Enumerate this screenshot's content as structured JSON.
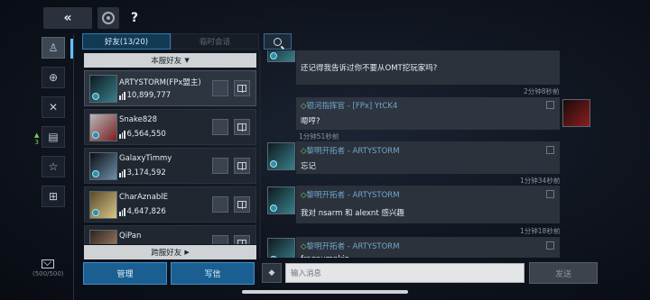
{
  "toolbar": {
    "back_label": "«",
    "refresh_icon": "refresh-icon",
    "help_label": "?"
  },
  "rail": {
    "items": [
      {
        "icon": "person-icon",
        "glyph": "♙"
      },
      {
        "icon": "globe-icon",
        "glyph": "⊕"
      },
      {
        "icon": "crossed-swords-icon",
        "glyph": "✕"
      },
      {
        "icon": "notes-icon",
        "glyph": "▤"
      },
      {
        "icon": "star-icon",
        "glyph": "☆"
      },
      {
        "icon": "gift-icon",
        "glyph": "⊞"
      }
    ],
    "notes_badge": "3",
    "mail_count": "(500/500)"
  },
  "tabs": {
    "friends": "好友(13/20)",
    "temp_chat": "临时会话"
  },
  "sections": {
    "local": "本服好友",
    "cross": "跨服好友"
  },
  "friends": [
    {
      "name": "ARTYSTORM(FPx盟主)",
      "power": "10,899,777",
      "colors": [
        "#0d1a1f",
        "#3a7f8a"
      ]
    },
    {
      "name": "Snake828",
      "power": "6,564,550",
      "colors": [
        "#b8b8b8",
        "#7a1f22"
      ]
    },
    {
      "name": "GalaxyTimmy",
      "power": "3,174,592",
      "colors": [
        "#0a0e14",
        "#6c8fa9"
      ]
    },
    {
      "name": "CharAznablE",
      "power": "4,647,826",
      "colors": [
        "#5a4b2a",
        "#d9c68a"
      ]
    },
    {
      "name": "QiPan",
      "power": "",
      "colors": [
        "#2a2520",
        "#b38a6a"
      ]
    }
  ],
  "actions": {
    "manage": "管理",
    "write": "写信"
  },
  "messages": [
    {
      "text": "还记得我告诉过你不要从OMT挖玩家吗?",
      "time": "2分钟8秒前"
    },
    {
      "sender": "银河指挥官",
      "tag": "[FPx] YtCK4",
      "text": "嗯哼?",
      "time": "1分钟51秒前"
    },
    {
      "sender": "黎明开拓者",
      "tag": "ARTYSTORM",
      "text": "忘记",
      "time": "1分钟34秒前"
    },
    {
      "sender": "黎明开拓者",
      "tag": "ARTYSTORM",
      "text": "我对 nsarm 和 alexnt 感兴趣",
      "time": "1分钟18秒前"
    },
    {
      "sender": "黎明开拓者",
      "tag": "ARTYSTORM",
      "text": "frogpumpkin",
      "time": ""
    }
  ],
  "input": {
    "placeholder": "输入消息",
    "send_label": "发送"
  }
}
